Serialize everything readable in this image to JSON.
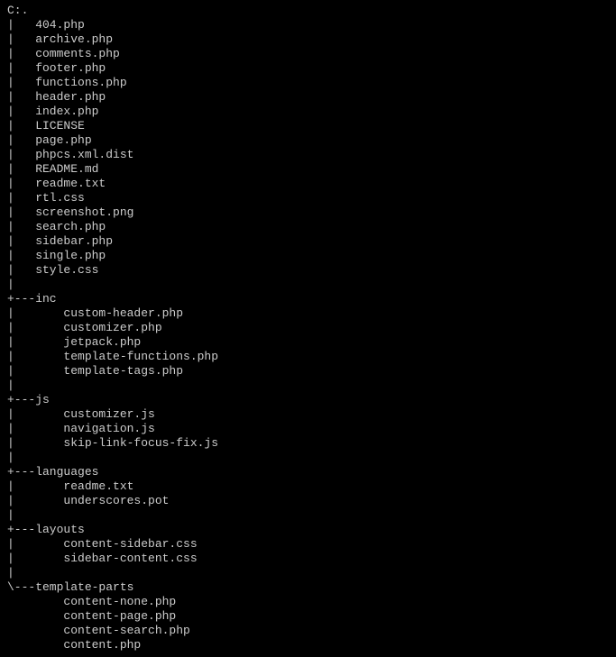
{
  "tree": {
    "root": "C:.",
    "rootFiles": [
      "404.php",
      "archive.php",
      "comments.php",
      "footer.php",
      "functions.php",
      "header.php",
      "index.php",
      "LICENSE",
      "page.php",
      "phpcs.xml.dist",
      "README.md",
      "readme.txt",
      "rtl.css",
      "screenshot.png",
      "search.php",
      "sidebar.php",
      "single.php",
      "style.css"
    ],
    "dirs": [
      {
        "name": "inc",
        "prefix": "+---",
        "files": [
          "custom-header.php",
          "customizer.php",
          "jetpack.php",
          "template-functions.php",
          "template-tags.php"
        ]
      },
      {
        "name": "js",
        "prefix": "+---",
        "files": [
          "customizer.js",
          "navigation.js",
          "skip-link-focus-fix.js"
        ]
      },
      {
        "name": "languages",
        "prefix": "+---",
        "files": [
          "readme.txt",
          "underscores.pot"
        ]
      },
      {
        "name": "layouts",
        "prefix": "+---",
        "files": [
          "content-sidebar.css",
          "sidebar-content.css"
        ]
      },
      {
        "name": "template-parts",
        "prefix": "\\---",
        "files": [
          "content-none.php",
          "content-page.php",
          "content-search.php",
          "content.php"
        ]
      }
    ]
  }
}
